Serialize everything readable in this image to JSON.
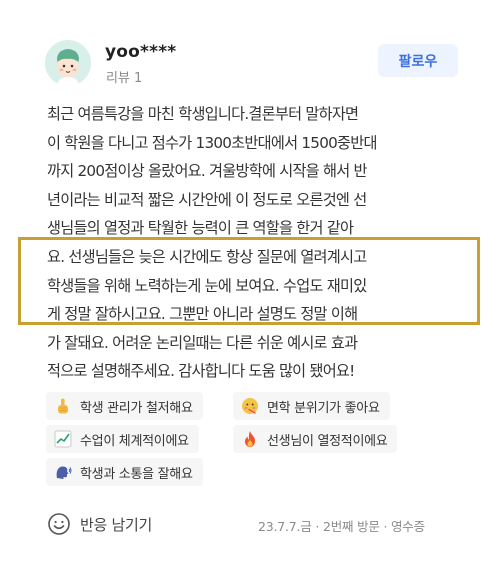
{
  "user": {
    "name": "yoo****",
    "review_count": "리뷰 1",
    "avatar_icon": "cartoon-face-avatar",
    "follow_label": "팔로우"
  },
  "review": {
    "lines": [
      "최근 여름특강을 마친 학생입니다.결론부터 말하자면",
      "이 학원을 다니고 점수가 1300초반대에서 1500중반대",
      "까지 200점이상 올랐어요. 겨울방학에 시작을 해서 반",
      "년이라는 비교적 짧은 시간안에 이 정도로 오른것엔 선",
      "생님들의 열정과 탁월한 능력이 큰 역할을 한거 같아",
      "요. 선생님들은 늦은 시간에도 항상 질문에 열려계시고",
      "학생들을 위해 노력하는게 눈에 보여요. 수업도 재미있",
      "게 정말 잘하시고요. 그뿐만 아니라 설명도 정말 이해",
      "가 잘돼요. 어려운 논리일때는 다른 쉬운 예시로 효과",
      "적으로 설명해주세요. 감사합니다 도움 많이 됐어요!"
    ],
    "highlight_color": "#c8a032"
  },
  "tags": [
    {
      "label": "학생 관리가 철저해요",
      "icon": "pointing-up-hand-icon"
    },
    {
      "label": "면학 분위기가 좋아요",
      "icon": "face-with-thermometer-icon"
    },
    {
      "label": "수업이 체계적이에요",
      "icon": "chart-increasing-icon"
    },
    {
      "label": "선생님이 열정적이에요",
      "icon": "fire-icon"
    },
    {
      "label": "학생과 소통을 잘해요",
      "icon": "speaking-head-icon"
    }
  ],
  "footer": {
    "reaction_label": "반응 남기기",
    "reaction_icon": "smile-icon",
    "visit_meta": "23.7.7.금 · 2번째 방문 · 영수증"
  },
  "colors": {
    "follow_bg": "#eef4ff",
    "follow_text": "#3c6fe0",
    "tag_bg": "#f6f6f6"
  }
}
